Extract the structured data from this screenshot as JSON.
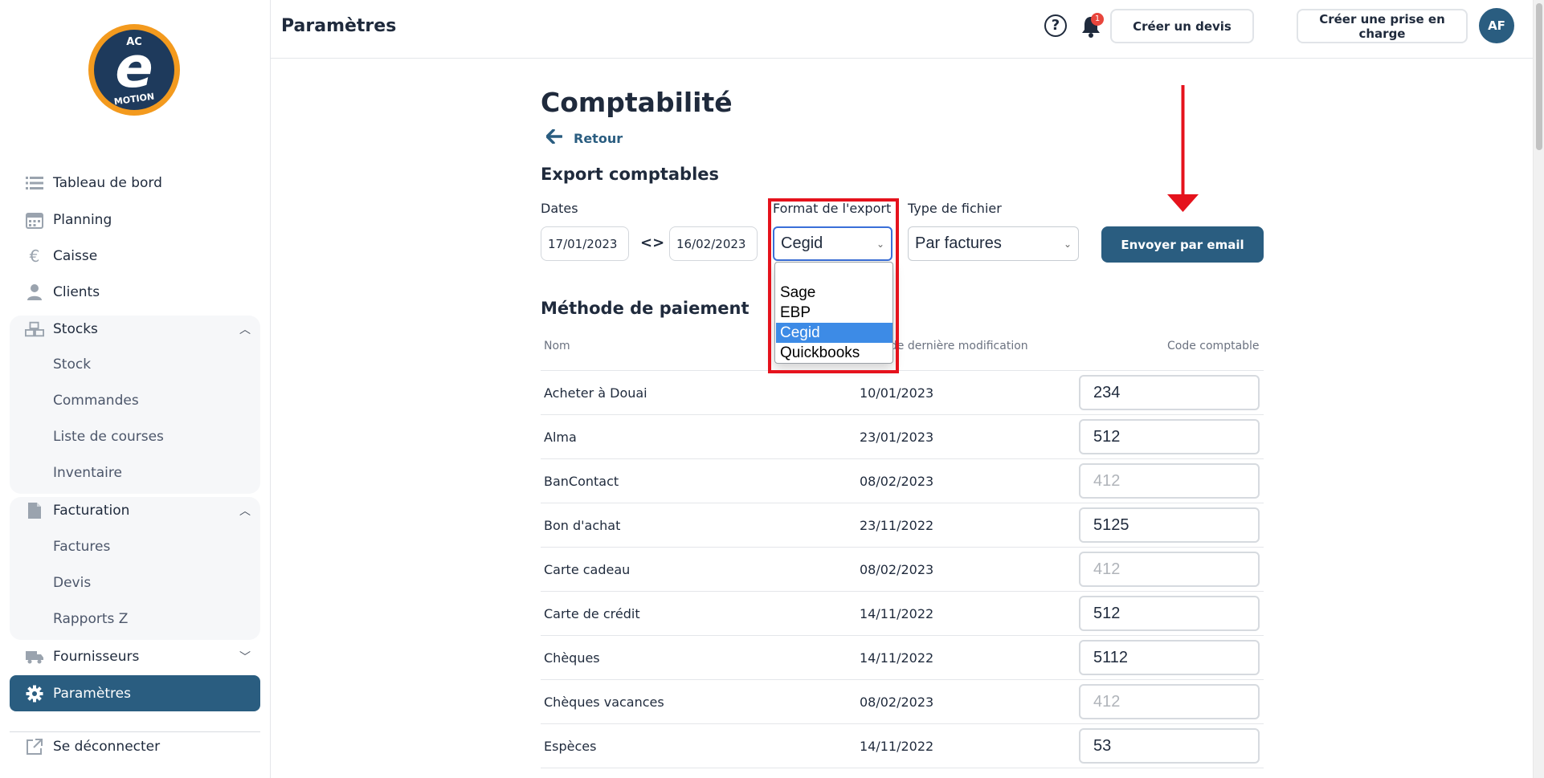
{
  "app": {
    "logo": {
      "top_text": "AC",
      "letter": "e",
      "bottom_text": "MOTION"
    }
  },
  "sidebar": {
    "items": [
      {
        "label": "Tableau de bord",
        "icon": "list-icon"
      },
      {
        "label": "Planning",
        "icon": "calendar-icon"
      },
      {
        "label": "Caisse",
        "icon": "euro-icon"
      },
      {
        "label": "Clients",
        "icon": "user-icon"
      },
      {
        "label": "Stocks",
        "icon": "boxes-icon"
      },
      {
        "label": "Facturation",
        "icon": "document-icon"
      },
      {
        "label": "Fournisseurs",
        "icon": "truck-icon"
      },
      {
        "label": "Paramètres",
        "icon": "gear-icon"
      },
      {
        "label": "Se déconnecter",
        "icon": "logout-icon"
      }
    ],
    "stocks_sub": [
      "Stock",
      "Commandes",
      "Liste de courses",
      "Inventaire"
    ],
    "facturation_sub": [
      "Factures",
      "Devis",
      "Rapports Z"
    ]
  },
  "header": {
    "title": "Paramètres",
    "help_glyph": "?",
    "notification_count": "1",
    "create_quote_label": "Créer un devis",
    "create_intake_label": "Créer une prise en charge",
    "avatar_initials": "AF"
  },
  "main": {
    "title": "Comptabilité",
    "back_label": "Retour",
    "export_section_title": "Export comptables",
    "dates_label": "Dates",
    "date_from": "17/01/2023",
    "date_between_glyph": "<>",
    "date_to": "16/02/2023",
    "format_label": "Format de l'export",
    "format_value": "Cegid",
    "format_options": [
      "",
      "Sage",
      "EBP",
      "Cegid",
      "Quickbooks"
    ],
    "format_selected_index": 3,
    "file_type_label": "Type de fichier",
    "file_type_value": "Par factures",
    "send_button_label": "Envoyer par email",
    "payment_section_title": "Méthode de paiement",
    "table_headers": {
      "name": "Nom",
      "date": "Date de dernière modification",
      "code": "Code comptable"
    },
    "rows": [
      {
        "name": "Acheter à Douai",
        "date": "10/01/2023",
        "code": "234",
        "placeholder": false
      },
      {
        "name": "Alma",
        "date": "23/01/2023",
        "code": "512",
        "placeholder": false
      },
      {
        "name": "BanContact",
        "date": "08/02/2023",
        "code": "412",
        "placeholder": true
      },
      {
        "name": "Bon d'achat",
        "date": "23/11/2022",
        "code": "5125",
        "placeholder": false
      },
      {
        "name": "Carte cadeau",
        "date": "08/02/2023",
        "code": "412",
        "placeholder": true
      },
      {
        "name": "Carte de crédit",
        "date": "14/11/2022",
        "code": "512",
        "placeholder": false
      },
      {
        "name": "Chèques",
        "date": "14/11/2022",
        "code": "5112",
        "placeholder": false
      },
      {
        "name": "Chèques vacances",
        "date": "08/02/2023",
        "code": "412",
        "placeholder": true
      },
      {
        "name": "Espèces",
        "date": "14/11/2022",
        "code": "53",
        "placeholder": false
      }
    ]
  },
  "colors": {
    "primary": "#2a5d80",
    "highlight_box": "#e5121c",
    "dropdown_selected": "#3d8be6",
    "badge": "#e8453c"
  }
}
